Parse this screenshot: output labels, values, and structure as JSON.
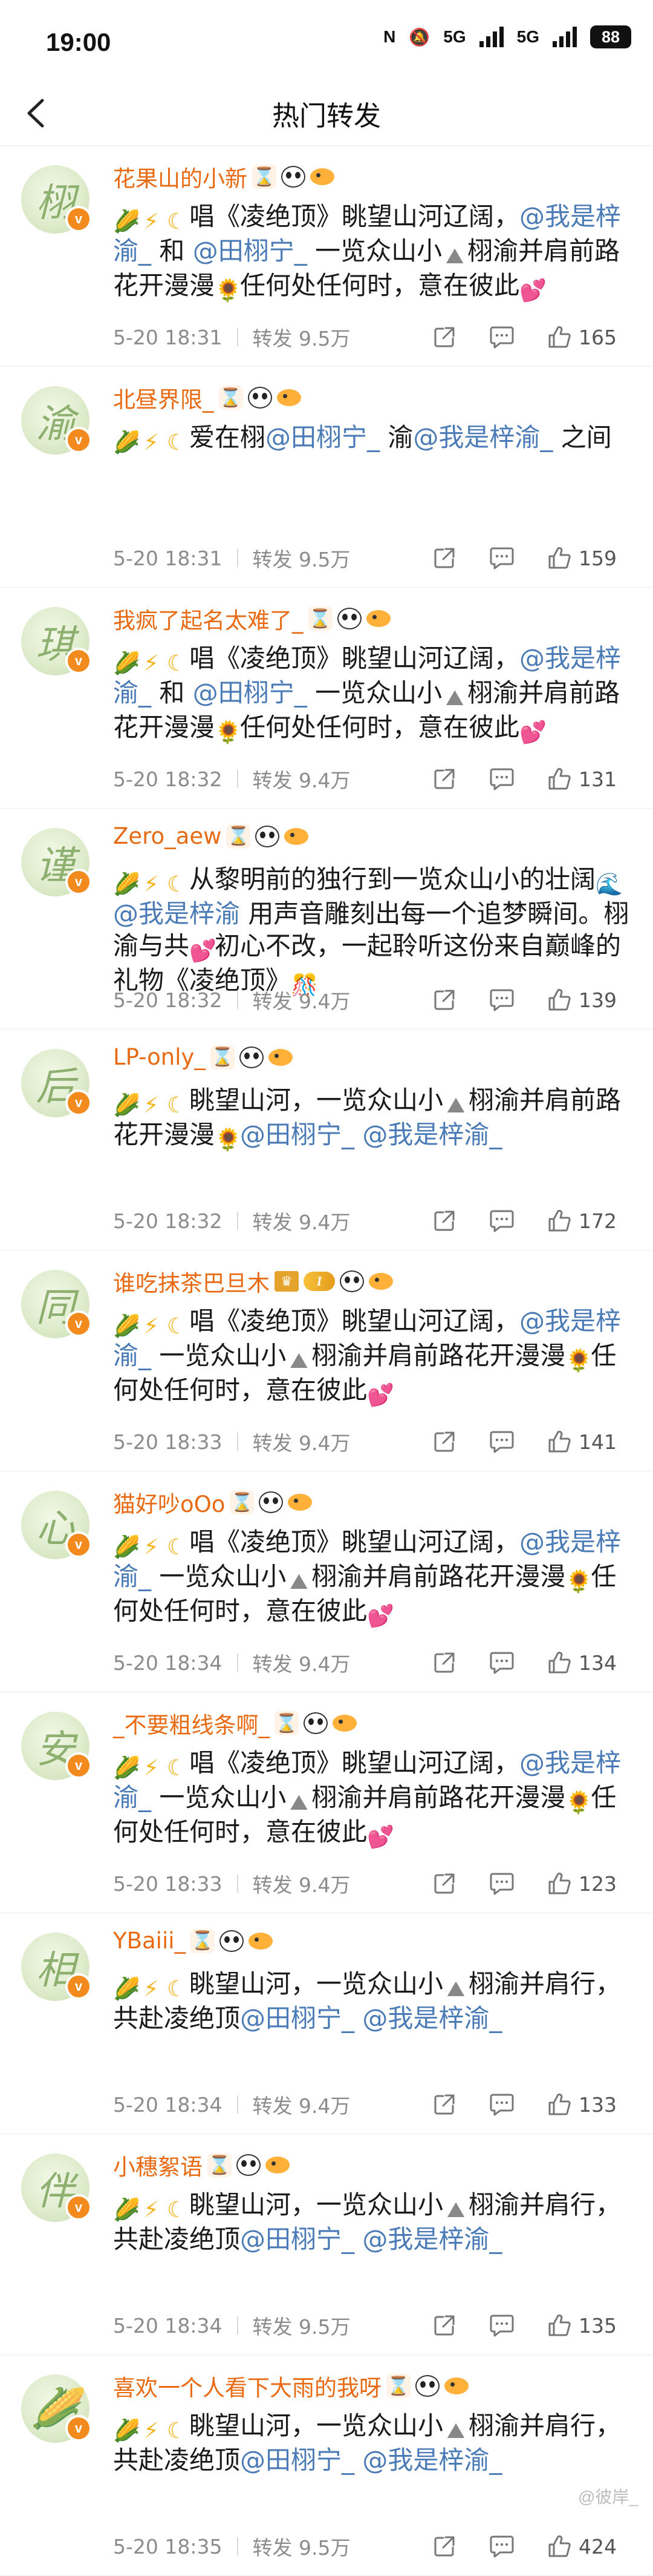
{
  "status": {
    "time": "19:00",
    "network": "5G",
    "network2": "5G",
    "battery": "88"
  },
  "nav": {
    "title": "热门转发"
  },
  "icons": {
    "back": "chevron-left-icon",
    "share": "share-icon",
    "comment": "comment-icon",
    "like": "thumbs-up-icon"
  },
  "colors": {
    "username": "#e86a12",
    "mention": "#4a7bb7",
    "meta": "#8c8c8c"
  },
  "comments": [
    {
      "name": "花果山的小新",
      "avatar_char": "栩",
      "text_segments": [
        {
          "t": "唱《凌绝顶》眺望山河辽阔，"
        },
        {
          "t": "@我是梓渝_",
          "m": true
        },
        {
          "t": " 和 "
        },
        {
          "t": "@田栩宁_",
          "m": true
        },
        {
          "t": " 一览众山小"
        },
        {
          "e": "mountain"
        },
        {
          "t": "栩渝并肩前路花开漫漫"
        },
        {
          "e": "sunflower"
        },
        {
          "t": "任何处任何时，意在彼此"
        },
        {
          "e": "heart"
        }
      ],
      "time": "5-20 18:31",
      "reposts": "转发 9.5万",
      "likes": "165"
    },
    {
      "name": "北昼界限_",
      "avatar_char": "渝",
      "text_segments": [
        {
          "t": "爱在栩"
        },
        {
          "t": "@田栩宁_",
          "m": true
        },
        {
          "t": " 渝"
        },
        {
          "t": "@我是梓渝_",
          "m": true
        },
        {
          "t": " 之间"
        }
      ],
      "time": "5-20 18:31",
      "reposts": "转发 9.5万",
      "likes": "159"
    },
    {
      "name": "我疯了起名太难了_",
      "avatar_char": "琪",
      "text_segments": [
        {
          "t": "唱《凌绝顶》眺望山河辽阔，"
        },
        {
          "t": "@我是梓渝_",
          "m": true
        },
        {
          "t": " 和 "
        },
        {
          "t": "@田栩宁_",
          "m": true
        },
        {
          "t": " 一览众山小"
        },
        {
          "e": "mountain"
        },
        {
          "t": "栩渝并肩前路花开漫漫"
        },
        {
          "e": "sunflower"
        },
        {
          "t": "任何处任何时，意在彼此"
        },
        {
          "e": "heart"
        }
      ],
      "time": "5-20 18:32",
      "reposts": "转发 9.4万",
      "likes": "131"
    },
    {
      "name": "Zero_aew",
      "avatar_char": "谨",
      "text_segments": [
        {
          "t": "从黎明前的独行到一览众山小的壮阔"
        },
        {
          "e": "wave"
        },
        {
          "t": "@我是梓渝",
          "m": true
        },
        {
          "t": " 用声音雕刻出每一个追梦瞬间。栩渝与共"
        },
        {
          "e": "heart"
        },
        {
          "t": "初心不改，一起聆听这份来自巅峰的礼物《凌绝顶》"
        },
        {
          "e": "firework"
        }
      ],
      "time": "5-20 18:32",
      "reposts": "转发 9.4万",
      "likes": "139"
    },
    {
      "name": "LP-only_",
      "avatar_char": "后",
      "text_segments": [
        {
          "t": "眺望山河，一览众山小"
        },
        {
          "e": "mountain"
        },
        {
          "t": "栩渝并肩前路花开漫漫"
        },
        {
          "e": "sunflower"
        },
        {
          "t": "@田栩宁_",
          "m": true
        },
        {
          "t": " "
        },
        {
          "t": "@我是梓渝_",
          "m": true
        }
      ],
      "time": "5-20 18:32",
      "reposts": "转发 9.4万",
      "likes": "172"
    },
    {
      "name": "谁吃抹茶巴旦木",
      "avatar_char": "同",
      "level": "I",
      "text_segments": [
        {
          "t": "唱《凌绝顶》眺望山河辽阔，"
        },
        {
          "t": "@我是梓渝_",
          "m": true
        },
        {
          "t": " 一览众山小"
        },
        {
          "e": "mountain"
        },
        {
          "t": "栩渝并肩前路花开漫漫"
        },
        {
          "e": "sunflower"
        },
        {
          "t": "任何处任何时，意在彼此"
        },
        {
          "e": "heart"
        }
      ],
      "time": "5-20 18:33",
      "reposts": "转发 9.4万",
      "likes": "141"
    },
    {
      "name": "猫好吵oOo",
      "avatar_char": "心",
      "text_segments": [
        {
          "t": "唱《凌绝顶》眺望山河辽阔，"
        },
        {
          "t": "@我是梓渝_",
          "m": true
        },
        {
          "t": " 一览众山小"
        },
        {
          "e": "mountain"
        },
        {
          "t": "栩渝并肩前路花开漫漫"
        },
        {
          "e": "sunflower"
        },
        {
          "t": "任何处任何时，意在彼此"
        },
        {
          "e": "heart"
        }
      ],
      "time": "5-20 18:34",
      "reposts": "转发 9.4万",
      "likes": "134"
    },
    {
      "name": "_不要粗线条啊_",
      "avatar_char": "安",
      "text_segments": [
        {
          "t": "唱《凌绝顶》眺望山河辽阔，"
        },
        {
          "t": "@我是梓渝_",
          "m": true
        },
        {
          "t": " 一览众山小"
        },
        {
          "e": "mountain"
        },
        {
          "t": "栩渝并肩前路花开漫漫"
        },
        {
          "e": "sunflower"
        },
        {
          "t": "任何处任何时，意在彼此"
        },
        {
          "e": "heart"
        }
      ],
      "time": "5-20 18:33",
      "reposts": "转发 9.4万",
      "likes": "123"
    },
    {
      "name": "YBaiii_",
      "avatar_char": "相",
      "text_segments": [
        {
          "t": "眺望山河，一览众山小"
        },
        {
          "e": "mountain"
        },
        {
          "t": "栩渝并肩行，共赴凌绝顶"
        },
        {
          "t": "@田栩宁_",
          "m": true
        },
        {
          "t": " "
        },
        {
          "t": "@我是梓渝_",
          "m": true
        }
      ],
      "time": "5-20 18:34",
      "reposts": "转发 9.4万",
      "likes": "133"
    },
    {
      "name": "小穗絮语",
      "avatar_char": "伴",
      "text_segments": [
        {
          "t": "眺望山河，一览众山小"
        },
        {
          "e": "mountain"
        },
        {
          "t": "栩渝并肩行，共赴凌绝顶"
        },
        {
          "t": "@田栩宁_",
          "m": true
        },
        {
          "t": " "
        },
        {
          "t": "@我是梓渝_",
          "m": true
        }
      ],
      "time": "5-20 18:34",
      "reposts": "转发 9.5万",
      "likes": "135"
    },
    {
      "name": "喜欢一个人看下大雨的我呀",
      "avatar_char": "🌽",
      "text_segments": [
        {
          "t": "眺望山河，一览众山小"
        },
        {
          "e": "mountain"
        },
        {
          "t": "栩渝并肩行，共赴凌绝顶"
        },
        {
          "t": "@田栩宁_",
          "m": true
        },
        {
          "t": " "
        },
        {
          "t": "@我是梓渝_",
          "m": true
        }
      ],
      "time": "5-20 18:35",
      "reposts": "转发 9.5万",
      "likes": "424"
    }
  ],
  "watermark": "@彼岸_"
}
